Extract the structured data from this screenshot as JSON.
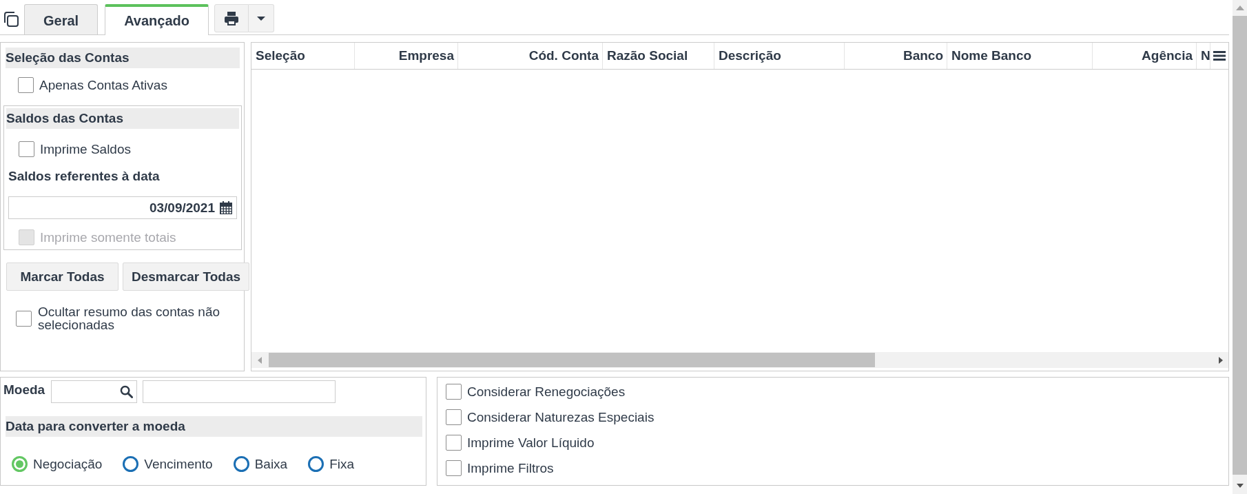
{
  "tabs": [
    {
      "label": "Geral",
      "selected": false
    },
    {
      "label": "Avançado",
      "selected": true
    }
  ],
  "account_selection": {
    "title": "Seleção das Contas",
    "active_only": {
      "label": "Apenas Contas Ativas",
      "checked": false
    }
  },
  "balances": {
    "title": "Saldos das Contas",
    "print_balances": {
      "label": "Imprime Saldos",
      "checked": false
    },
    "date_label": "Saldos referentes à data",
    "date_value": "03/09/2021",
    "totals_only": {
      "label": "Imprime somente totais",
      "checked": false,
      "disabled": true
    }
  },
  "selection_buttons": [
    "Marcar Todas",
    "Desmarcar Todas"
  ],
  "hide_summary": {
    "label": "Ocultar resumo das contas não selecionadas",
    "checked": false
  },
  "table": {
    "columns": [
      {
        "label": "Seleção",
        "kind": "text"
      },
      {
        "label": "Empresa",
        "kind": "numeric"
      },
      {
        "label": "Cód. Conta",
        "kind": "numeric"
      },
      {
        "label": "Razão Social",
        "kind": "text"
      },
      {
        "label": "Descrição",
        "kind": "text"
      },
      {
        "label": "Banco",
        "kind": "numeric"
      },
      {
        "label": "Nome Banco",
        "kind": "text"
      },
      {
        "label": "Agência",
        "kind": "numeric"
      },
      {
        "label": "N",
        "kind": "text"
      }
    ]
  },
  "currency": {
    "label": "Moeda",
    "conversion_date": {
      "title": "Data para converter a moeda",
      "options": [
        {
          "label": "Negociação",
          "selected": true
        },
        {
          "label": "Vencimento",
          "selected": false
        },
        {
          "label": "Baixa",
          "selected": false
        },
        {
          "label": "Fixa",
          "selected": false
        }
      ]
    }
  },
  "options": [
    {
      "label": "Considerar Renegociações",
      "checked": false
    },
    {
      "label": "Considerar Naturezas Especiais",
      "checked": false
    },
    {
      "label": "Imprime Valor Líquido",
      "checked": false
    },
    {
      "label": "Imprime Filtros",
      "checked": false
    }
  ]
}
